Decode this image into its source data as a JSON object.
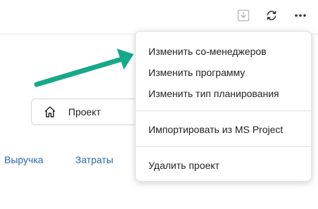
{
  "toolbar": {
    "import_icon": "import-download-icon",
    "refresh_icon": "refresh-icon",
    "more_icon": "more-horizontal-icon"
  },
  "project_selector": {
    "icon": "home-icon",
    "label": "Проект"
  },
  "tabs": [
    {
      "label": "Выручка"
    },
    {
      "label": "Затраты"
    }
  ],
  "menu": {
    "items": [
      {
        "label": "Изменить со-менеджеров"
      },
      {
        "label": "Изменить программу"
      },
      {
        "label": "Изменить тип планирования"
      },
      {
        "label": "Импортировать из MS Project"
      },
      {
        "label": "Удалить проект"
      }
    ]
  },
  "annotation": {
    "arrow_color": "#17a889"
  },
  "colors": {
    "link": "#2b6aa8",
    "text": "#222222"
  }
}
